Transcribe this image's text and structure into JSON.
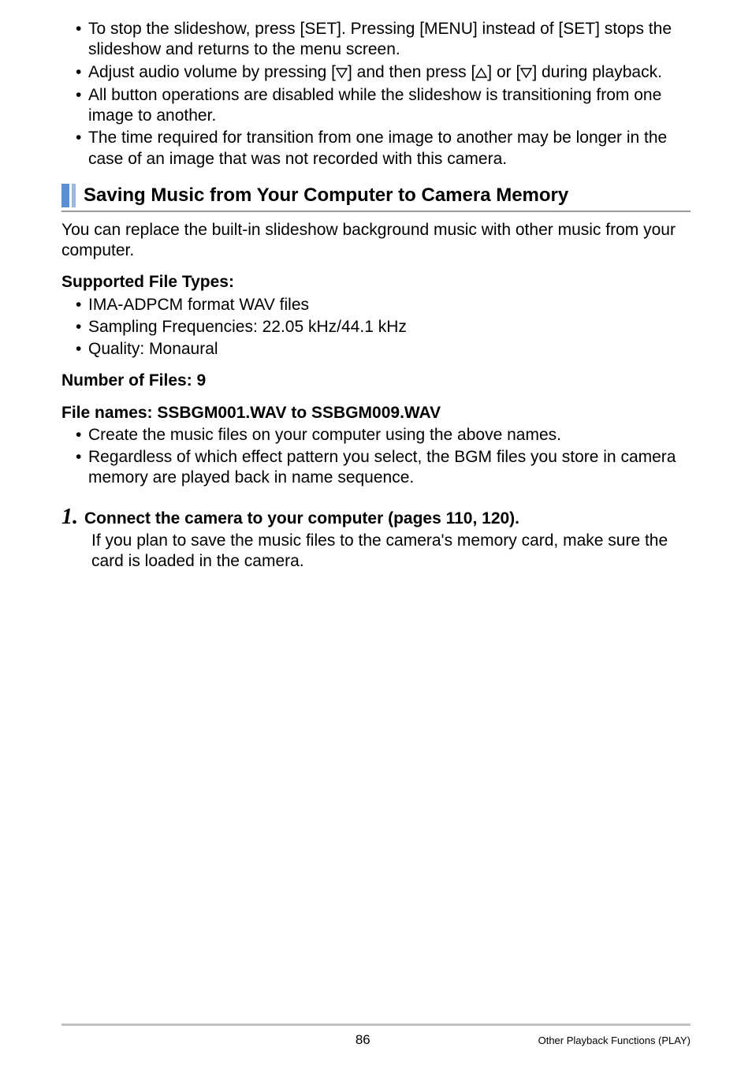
{
  "bullets": {
    "b1a": "To stop the slideshow, press [SET]. Pressing [MENU] instead of [SET] stops the slideshow and returns to the menu screen.",
    "b2_pre": "Adjust audio volume by pressing [",
    "b2_mid1": "] and then press [",
    "b2_mid2": "] or [",
    "b2_post": "] during playback.",
    "b3": "All button operations are disabled while the slideshow is transitioning from one image to another.",
    "b4": "The time required for transition from one image to another may be longer in the case of an image that was not recorded with this camera."
  },
  "section": {
    "title": "Saving Music from Your Computer to Camera Memory",
    "intro": "You can replace the built-in slideshow background music with other music from your computer."
  },
  "supported": {
    "heading": "Supported File Types:",
    "i1": "IMA-ADPCM format WAV files",
    "i2": "Sampling Frequencies: 22.05 kHz/44.1 kHz",
    "i3": "Quality: Monaural"
  },
  "numfiles": "Number of Files: 9",
  "filenames": {
    "heading": "File names: SSBGM001.WAV to SSBGM009.WAV",
    "i1": "Create the music files on your computer using the above names.",
    "i2": "Regardless of which effect pattern you select, the BGM files you store in camera memory are played back in name sequence."
  },
  "step": {
    "num": "1.",
    "title": "Connect the camera to your computer (pages 110, 120).",
    "body": "If you plan to save the music files to the camera's memory card, make sure the card is loaded in the camera."
  },
  "footer": {
    "page": "86",
    "label": "Other Playback Functions (PLAY)"
  }
}
